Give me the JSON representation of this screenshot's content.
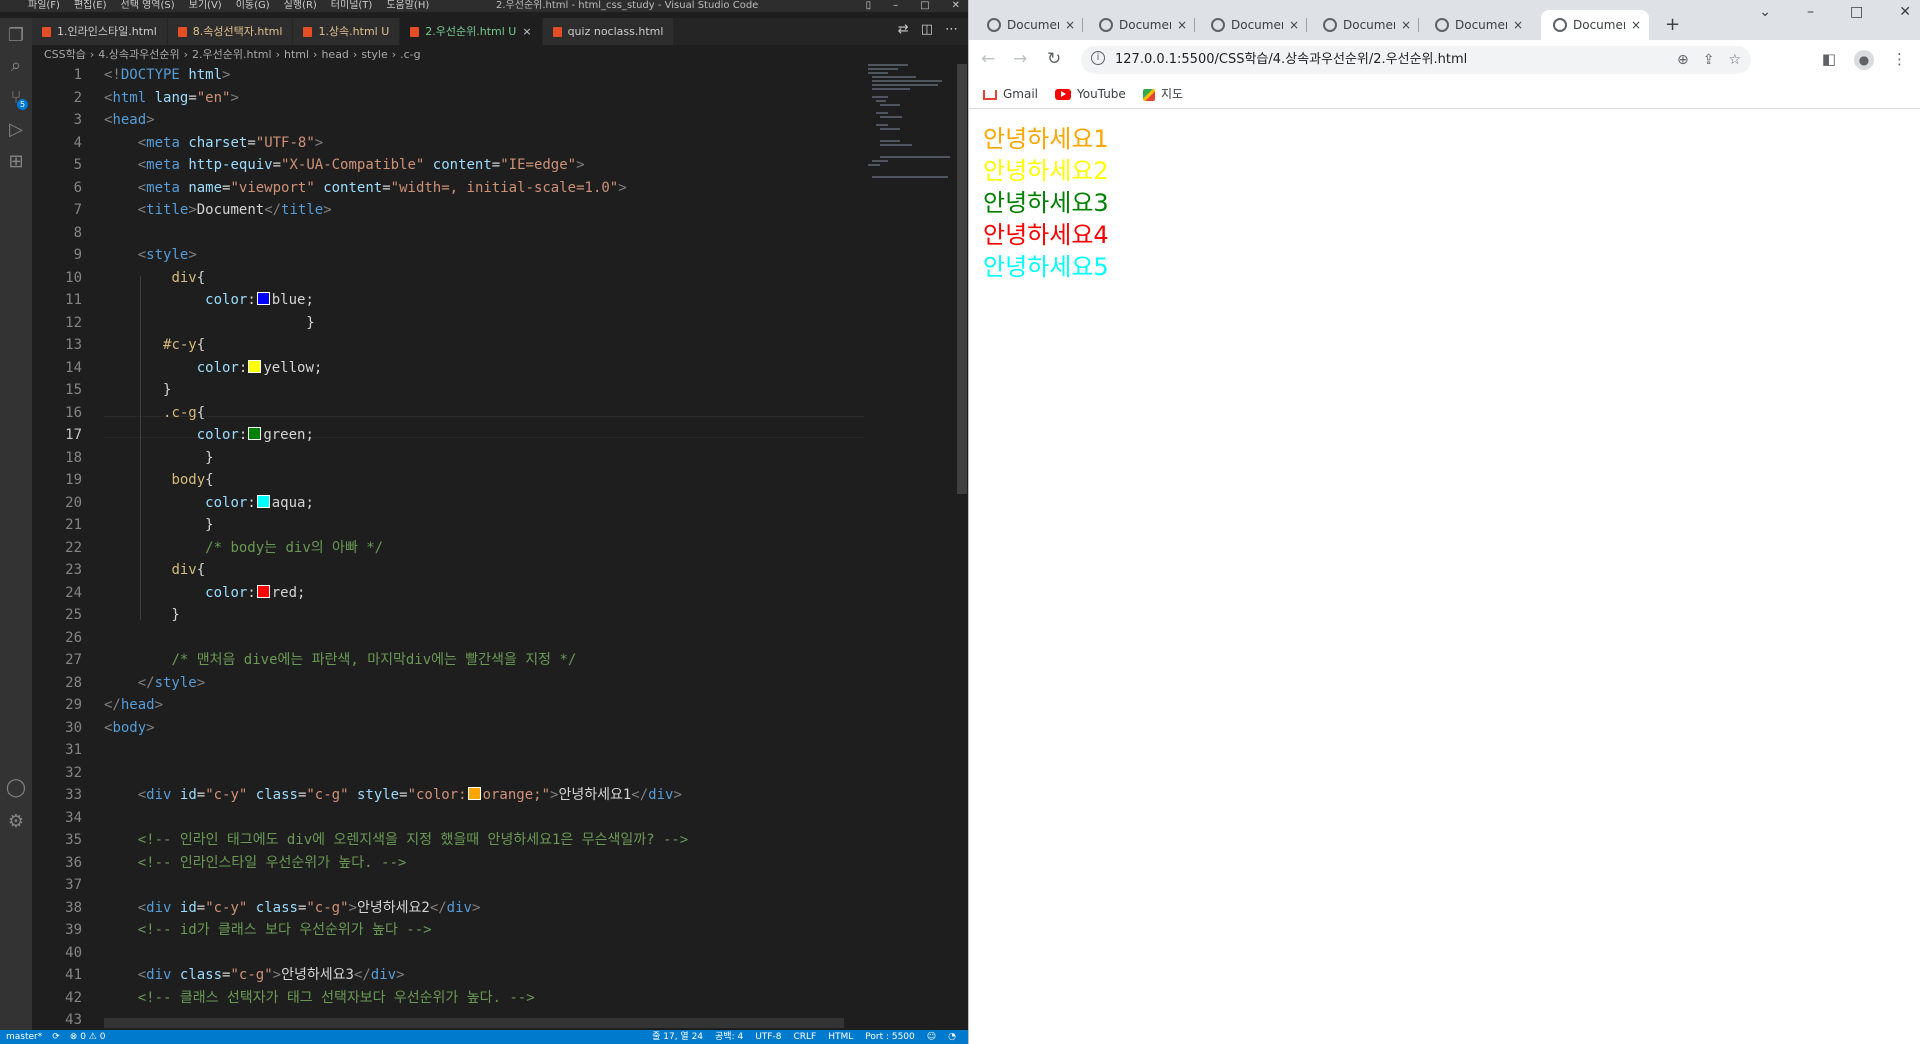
{
  "vscode": {
    "menu": [
      "파일(F)",
      "편집(E)",
      "선택 영역(S)",
      "보기(V)",
      "이동(G)",
      "실행(R)",
      "터미널(T)",
      "도움말(H)"
    ],
    "window_title": "2.우선순위.html - html_css_study - Visual Studio Code",
    "tabs": [
      {
        "label": "1.인라인스타일.html",
        "state": "plain"
      },
      {
        "label": "8.속성선택자.html",
        "state": "warn"
      },
      {
        "label": "1.상속.html U",
        "state": "warn"
      },
      {
        "label": "2.우선순위.html U",
        "state": "active",
        "close": "×"
      },
      {
        "label": "quiz noclass.html",
        "state": "plain"
      }
    ],
    "breadcrumb": [
      "CSS학습",
      "4.상속과우선순위",
      "2.우선순위.html",
      "html",
      "head",
      "style",
      ".c-g"
    ],
    "current_line": 17,
    "status": {
      "branch": "master*",
      "errors": "⊗ 0 ⚠ 0",
      "position": "줄 17, 열 24",
      "spaces": "공백: 4",
      "encoding": "UTF-8",
      "eol": "CRLF",
      "language": "HTML",
      "port": "Port : 5500"
    }
  },
  "code": [
    [
      [
        "b",
        "<!"
      ],
      [
        "t",
        "DOCTYPE"
      ],
      [
        "v",
        " "
      ],
      [
        "a",
        "html"
      ],
      [
        "b",
        ">"
      ]
    ],
    [
      [
        "b",
        "<"
      ],
      [
        "t",
        "html"
      ],
      [
        "v",
        " "
      ],
      [
        "a",
        "lang"
      ],
      [
        "v",
        "="
      ],
      [
        "s",
        "\"en\""
      ],
      [
        "b",
        ">"
      ]
    ],
    [
      [
        "b",
        "<"
      ],
      [
        "t",
        "head"
      ],
      [
        "b",
        ">"
      ]
    ],
    [
      [
        "v",
        "    "
      ],
      [
        "b",
        "<"
      ],
      [
        "t",
        "meta"
      ],
      [
        "v",
        " "
      ],
      [
        "a",
        "charset"
      ],
      [
        "v",
        "="
      ],
      [
        "s",
        "\"UTF-8\""
      ],
      [
        "b",
        ">"
      ]
    ],
    [
      [
        "v",
        "    "
      ],
      [
        "b",
        "<"
      ],
      [
        "t",
        "meta"
      ],
      [
        "v",
        " "
      ],
      [
        "a",
        "http-equiv"
      ],
      [
        "v",
        "="
      ],
      [
        "s",
        "\"X-UA-Compatible\""
      ],
      [
        "v",
        " "
      ],
      [
        "a",
        "content"
      ],
      [
        "v",
        "="
      ],
      [
        "s",
        "\"IE=edge\""
      ],
      [
        "b",
        ">"
      ]
    ],
    [
      [
        "v",
        "    "
      ],
      [
        "b",
        "<"
      ],
      [
        "t",
        "meta"
      ],
      [
        "v",
        " "
      ],
      [
        "a",
        "name"
      ],
      [
        "v",
        "="
      ],
      [
        "s",
        "\"viewport\""
      ],
      [
        "v",
        " "
      ],
      [
        "a",
        "content"
      ],
      [
        "v",
        "="
      ],
      [
        "s",
        "\"width=, initial-scale=1.0\""
      ],
      [
        "b",
        ">"
      ]
    ],
    [
      [
        "v",
        "    "
      ],
      [
        "b",
        "<"
      ],
      [
        "t",
        "title"
      ],
      [
        "b",
        ">"
      ],
      [
        "txt",
        "Document"
      ],
      [
        "b",
        "</"
      ],
      [
        "t",
        "title"
      ],
      [
        "b",
        ">"
      ]
    ],
    [],
    [
      [
        "v",
        "    "
      ],
      [
        "b",
        "<"
      ],
      [
        "t",
        "style"
      ],
      [
        "b",
        ">"
      ]
    ],
    [
      [
        "v",
        "        "
      ],
      [
        "sel",
        "div"
      ],
      [
        "v",
        "{"
      ]
    ],
    [
      [
        "v",
        "            "
      ],
      [
        "p",
        "color"
      ],
      [
        "v",
        ":"
      ],
      [
        "sw",
        "#0000ff"
      ],
      [
        "v",
        "blue;"
      ]
    ],
    [
      [
        "v",
        "                        }"
      ]
    ],
    [
      [
        "v",
        "       "
      ],
      [
        "sel",
        "#c-y"
      ],
      [
        "v",
        "{"
      ]
    ],
    [
      [
        "v",
        "           "
      ],
      [
        "p",
        "color"
      ],
      [
        "v",
        ":"
      ],
      [
        "sw",
        "#ffff00"
      ],
      [
        "v",
        "yellow;"
      ]
    ],
    [
      [
        "v",
        "       }"
      ]
    ],
    [
      [
        "v",
        "       "
      ],
      [
        "sel",
        ".c-g"
      ],
      [
        "v",
        "{"
      ]
    ],
    [
      [
        "v",
        "           "
      ],
      [
        "p",
        "color"
      ],
      [
        "v",
        ":"
      ],
      [
        "sw",
        "#008000"
      ],
      [
        "v",
        "green;"
      ]
    ],
    [
      [
        "v",
        "            }"
      ]
    ],
    [
      [
        "v",
        "        "
      ],
      [
        "sel",
        "body"
      ],
      [
        "v",
        "{"
      ]
    ],
    [
      [
        "v",
        "            "
      ],
      [
        "p",
        "color"
      ],
      [
        "v",
        ":"
      ],
      [
        "sw",
        "#00ffff"
      ],
      [
        "v",
        "aqua;"
      ]
    ],
    [
      [
        "v",
        "            }"
      ]
    ],
    [
      [
        "v",
        "            "
      ],
      [
        "c",
        "/* body는 div의 아빠 */"
      ]
    ],
    [
      [
        "v",
        "        "
      ],
      [
        "sel",
        "div"
      ],
      [
        "v",
        "{"
      ]
    ],
    [
      [
        "v",
        "            "
      ],
      [
        "p",
        "color"
      ],
      [
        "v",
        ":"
      ],
      [
        "sw",
        "#ff0000"
      ],
      [
        "v",
        "red;"
      ]
    ],
    [
      [
        "v",
        "        }"
      ]
    ],
    [],
    [
      [
        "v",
        "        "
      ],
      [
        "c",
        "/* 맨처음 dive에는 파란색, 마지막div에는 빨간색을 지정 */"
      ]
    ],
    [
      [
        "v",
        "    "
      ],
      [
        "b",
        "</"
      ],
      [
        "t",
        "style"
      ],
      [
        "b",
        ">"
      ]
    ],
    [
      [
        "b",
        "</"
      ],
      [
        "t",
        "head"
      ],
      [
        "b",
        ">"
      ]
    ],
    [
      [
        "b",
        "<"
      ],
      [
        "t",
        "body"
      ],
      [
        "b",
        ">"
      ]
    ],
    [],
    [],
    [
      [
        "v",
        "    "
      ],
      [
        "b",
        "<"
      ],
      [
        "t",
        "div"
      ],
      [
        "v",
        " "
      ],
      [
        "a",
        "id"
      ],
      [
        "v",
        "="
      ],
      [
        "s",
        "\"c-y\""
      ],
      [
        "v",
        " "
      ],
      [
        "a",
        "class"
      ],
      [
        "v",
        "="
      ],
      [
        "s",
        "\"c-g\""
      ],
      [
        "v",
        " "
      ],
      [
        "a",
        "style"
      ],
      [
        "v",
        "="
      ],
      [
        "s",
        "\"color:"
      ],
      [
        "sw",
        "#ffa500"
      ],
      [
        "s",
        "orange;\""
      ],
      [
        "b",
        ">"
      ],
      [
        "txt",
        "안녕하세요1"
      ],
      [
        "b",
        "</"
      ],
      [
        "t",
        "div"
      ],
      [
        "b",
        ">"
      ]
    ],
    [],
    [
      [
        "v",
        "    "
      ],
      [
        "c",
        "<!-- 인라인 태그에도 div에 오렌지색을 지정 했을때 안녕하세요1은 무슨색일까? -->"
      ]
    ],
    [
      [
        "v",
        "    "
      ],
      [
        "c",
        "<!-- 인라인스타일 우선순위가 높다. -->"
      ]
    ],
    [],
    [
      [
        "v",
        "    "
      ],
      [
        "b",
        "<"
      ],
      [
        "t",
        "div"
      ],
      [
        "v",
        " "
      ],
      [
        "a",
        "id"
      ],
      [
        "v",
        "="
      ],
      [
        "s",
        "\"c-y\""
      ],
      [
        "v",
        " "
      ],
      [
        "a",
        "class"
      ],
      [
        "v",
        "="
      ],
      [
        "s",
        "\"c-g\""
      ],
      [
        "b",
        ">"
      ],
      [
        "txt",
        "안녕하세요2"
      ],
      [
        "b",
        "</"
      ],
      [
        "t",
        "div"
      ],
      [
        "b",
        ">"
      ]
    ],
    [
      [
        "v",
        "    "
      ],
      [
        "c",
        "<!-- id가 클래스 보다 우선순위가 높다 -->"
      ]
    ],
    [],
    [
      [
        "v",
        "    "
      ],
      [
        "b",
        "<"
      ],
      [
        "t",
        "div"
      ],
      [
        "v",
        " "
      ],
      [
        "a",
        "class"
      ],
      [
        "v",
        "="
      ],
      [
        "s",
        "\"c-g\""
      ],
      [
        "b",
        ">"
      ],
      [
        "txt",
        "안녕하세요3"
      ],
      [
        "b",
        "</"
      ],
      [
        "t",
        "div"
      ],
      [
        "b",
        ">"
      ]
    ],
    [
      [
        "v",
        "    "
      ],
      [
        "c",
        "<!-- 클래스 선택자가 태그 선택자보다 우선순위가 높다. -->"
      ]
    ],
    []
  ],
  "chrome": {
    "tabs": [
      {
        "title": "Document",
        "close": "×"
      },
      {
        "title": "Document",
        "close": "×"
      },
      {
        "title": "Document",
        "close": "×"
      },
      {
        "title": "Document",
        "close": "×"
      },
      {
        "title": "Document",
        "close": "×"
      },
      {
        "title": "Document",
        "close": "×",
        "active": true
      }
    ],
    "new_tab": "+",
    "url": "127.0.0.1:5500/CSS학습/4.상속과우선순위/2.우선순위.html",
    "bookmarks": [
      {
        "label": "Gmail",
        "icon": "gmail-icon"
      },
      {
        "label": "YouTube",
        "icon": "youtube-icon"
      },
      {
        "label": "지도",
        "icon": "maps-icon"
      }
    ],
    "page_lines": [
      {
        "text": "안녕하세요1",
        "color": "#ffa500"
      },
      {
        "text": "안녕하세요2",
        "color": "#ffff00"
      },
      {
        "text": "안녕하세요3",
        "color": "#008000"
      },
      {
        "text": "안녕하세요4",
        "color": "#ff0000"
      },
      {
        "text": "안녕하세요5",
        "color": "#00ffff"
      }
    ]
  }
}
